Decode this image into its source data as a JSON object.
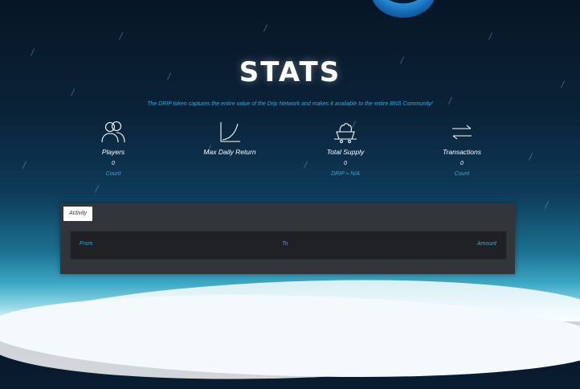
{
  "page": {
    "title": "STATS",
    "subtitle": "The DRIP token captures the entire value of the Drip Network and makes it available to the entire BNS Community!"
  },
  "stats": [
    {
      "label": "Players",
      "value": "0",
      "sub": "Count",
      "icon": "players-icon"
    },
    {
      "label": "Max Daily Return",
      "value": "",
      "sub": "",
      "icon": "chart-curve-icon"
    },
    {
      "label": "Total Supply",
      "value": "0",
      "sub": "DRIP ≈ N/A",
      "icon": "supply-cart-icon"
    },
    {
      "label": "Transactions",
      "value": "0",
      "sub": "Count",
      "icon": "transfer-arrows-icon"
    }
  ],
  "activity": {
    "tab_label": "Activity",
    "columns": [
      "From",
      "To",
      "Amount"
    ]
  },
  "colors": {
    "accent": "#35a9d8",
    "panel": "#323539",
    "table": "#1f2124",
    "text": "#ffffff"
  }
}
